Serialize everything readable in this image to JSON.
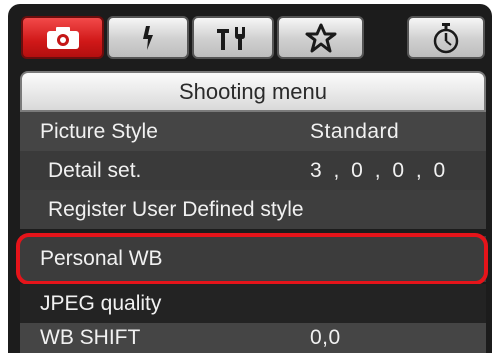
{
  "tabs": [
    {
      "icon": "camera-icon",
      "active": true
    },
    {
      "icon": "playback-icon",
      "active": false
    },
    {
      "icon": "setup-wrench-icon",
      "active": false
    },
    {
      "icon": "my-menu-star-icon",
      "active": false
    },
    {
      "icon": "timer-icon",
      "active": false
    }
  ],
  "menu": {
    "title": "Shooting menu",
    "items": [
      {
        "label": "Picture Style",
        "value": "Standard"
      },
      {
        "label": "Detail set.",
        "value": "3 , 0 , 0 , 0"
      },
      {
        "label": "Register User Defined style"
      },
      {
        "label": "Personal WB",
        "selected": true
      },
      {
        "label": "JPEG quality"
      },
      {
        "label": "WB SHIFT",
        "value": "0,0"
      }
    ]
  },
  "colors": {
    "active_tab": "#d01818",
    "highlight": "#e5141a",
    "menu_bg": "#1c1c1c"
  }
}
